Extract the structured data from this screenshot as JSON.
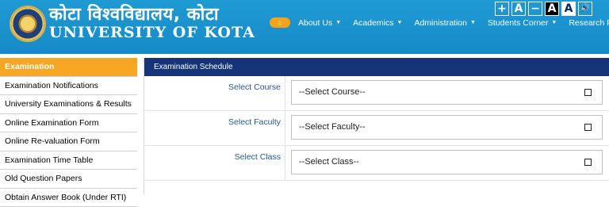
{
  "header": {
    "logo_text": "UNIVERSITY OF KOTA",
    "title_hindi": "कोटा विश्वविद्यालय, कोटा",
    "title_english": "UNIVERSITY OF KOTA",
    "accessibility": {
      "increase": "+",
      "normal_a": "A",
      "decrease": "−",
      "dark_a": "A",
      "light_a": "A",
      "speaker": "🔊"
    },
    "home_icon": "home-icon",
    "nav": [
      {
        "label": "About Us",
        "dropdown": true
      },
      {
        "label": "Academics",
        "dropdown": true
      },
      {
        "label": "Administration",
        "dropdown": true
      },
      {
        "label": "Students Corner",
        "dropdown": true
      },
      {
        "label": "Research Portal",
        "dropdown": false
      }
    ]
  },
  "sidebar": {
    "items": [
      {
        "label": "Examination",
        "active": true
      },
      {
        "label": "Examination Notifications"
      },
      {
        "label": "University Examinations & Results"
      },
      {
        "label": "Online Examination Form"
      },
      {
        "label": "Online Re-valuation Form"
      },
      {
        "label": "Examination Time Table"
      },
      {
        "label": "Old Question Papers"
      },
      {
        "label": "Obtain Answer Book (Under RTI)"
      }
    ]
  },
  "main": {
    "panel_title": "Examination Schedule",
    "fields": [
      {
        "label": "Select Course",
        "value": "--Select Course--"
      },
      {
        "label": "Select Faculty",
        "value": "--Select Faculty--"
      },
      {
        "label": "Select Class",
        "value": "--Select Class--"
      }
    ]
  },
  "colors": {
    "header_blue": "#1a92cf",
    "panel_navy": "#16347a",
    "active_orange": "#f6a623",
    "label_blue": "#24588f"
  }
}
